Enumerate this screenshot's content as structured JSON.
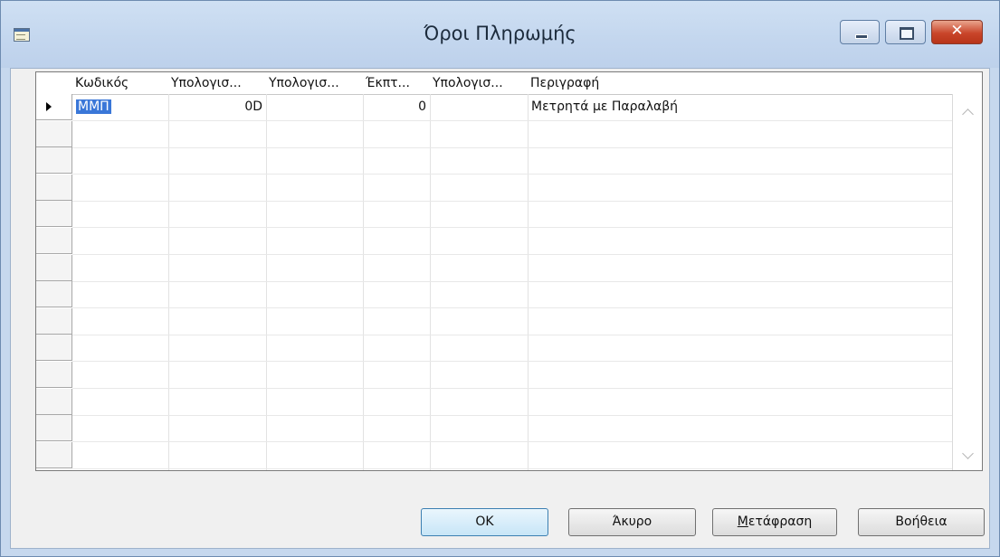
{
  "window": {
    "title": "Όροι Πληρωμής",
    "close_glyph": "✕"
  },
  "grid": {
    "columns": [
      {
        "label": "Κωδικός"
      },
      {
        "label": "Υπολογισ..."
      },
      {
        "label": "Υπολογισ..."
      },
      {
        "label": "Έκπτ..."
      },
      {
        "label": "Υπολογισ..."
      },
      {
        "label": "Περιγραφή"
      }
    ],
    "rows": [
      {
        "code": "ΜΜΠ",
        "due_date_calc": "0D",
        "discount_date_calc": "",
        "discount_pct": "0",
        "calc_other": "",
        "description": "Μετρητά με Παραλαβή"
      }
    ],
    "empty_rows": 13
  },
  "buttons": {
    "ok": "OK",
    "cancel": "Άκυρο",
    "translate_first": "Μ",
    "translate_rest": "ετάφραση",
    "help": "Βοήθεια"
  },
  "colors": {
    "selection": "#3a77d8",
    "title_bar": "#c3d6ee",
    "close_button": "#c9452a"
  }
}
